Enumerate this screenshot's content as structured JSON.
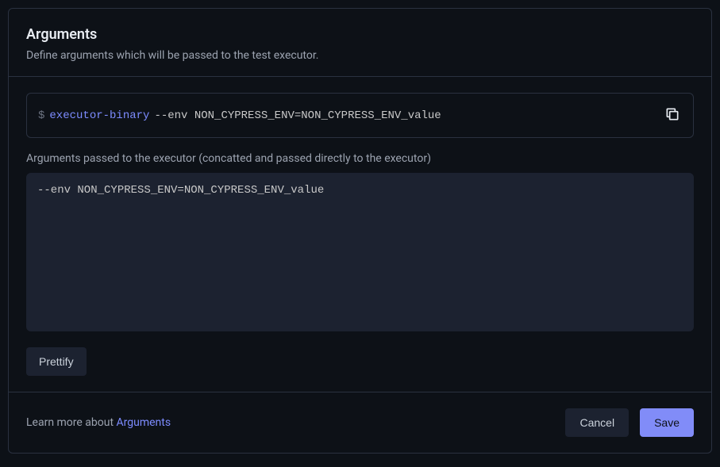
{
  "header": {
    "title": "Arguments",
    "subtitle": "Define arguments which will be passed to the test executor."
  },
  "command": {
    "prompt": "$",
    "binary": "executor-binary",
    "args": "--env NON_CYPRESS_ENV=NON_CYPRESS_ENV_value"
  },
  "body": {
    "args_label": "Arguments passed to the executor (concatted and passed directly to the executor)",
    "args_value": "--env NON_CYPRESS_ENV=NON_CYPRESS_ENV_value",
    "prettify_label": "Prettify"
  },
  "footer": {
    "learn_prefix": "Learn more about ",
    "learn_link": "Arguments",
    "cancel_label": "Cancel",
    "save_label": "Save"
  }
}
